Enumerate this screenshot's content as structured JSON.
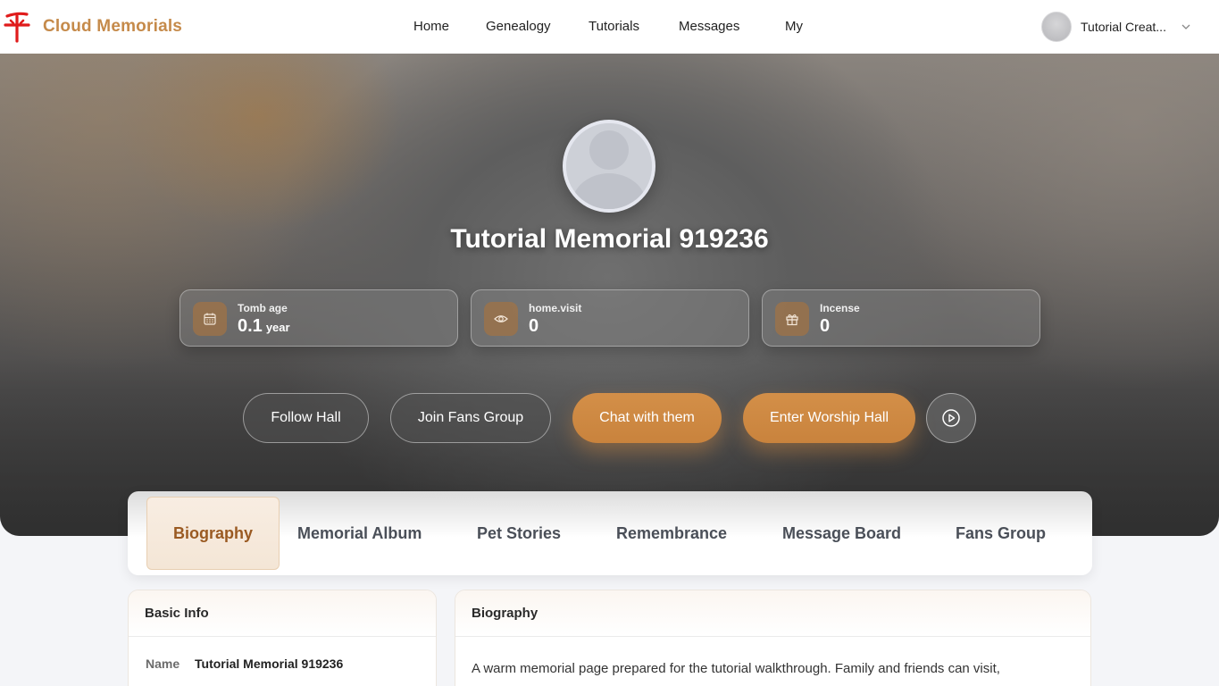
{
  "header": {
    "brand": "Cloud Memorials",
    "nav": [
      "Home",
      "Genealogy",
      "Tutorials",
      "Messages",
      "My"
    ],
    "user_name": "Tutorial Creat..."
  },
  "hero": {
    "title": "Tutorial Memorial 919236",
    "stats": [
      {
        "label": "Tomb age",
        "value": "0.1",
        "unit": "year",
        "icon": "calendar-icon"
      },
      {
        "label": "home.visit",
        "value": "0",
        "unit": "",
        "icon": "eye-icon"
      },
      {
        "label": "Incense",
        "value": "0",
        "unit": "",
        "icon": "gift-icon"
      }
    ],
    "buttons": {
      "follow": "Follow Hall",
      "join": "Join Fans Group",
      "chat": "Chat with them",
      "enter": "Enter Worship Hall"
    }
  },
  "tabs": [
    "Biography",
    "Memorial Album",
    "Pet Stories",
    "Remembrance",
    "Message Board",
    "Fans Group"
  ],
  "active_tab": "Biography",
  "basic_info": {
    "title": "Basic Info",
    "rows": [
      {
        "key": "Name",
        "value": "Tutorial Memorial 919236"
      }
    ]
  },
  "biography": {
    "title": "Biography",
    "text": "A warm memorial page prepared for the tutorial walkthrough. Family and friends can visit,"
  },
  "colors": {
    "brand": "#c58a4a",
    "primary_button": "#cd8a43",
    "active_tab_text": "#9a5a22",
    "logo": "#e01b1b"
  }
}
